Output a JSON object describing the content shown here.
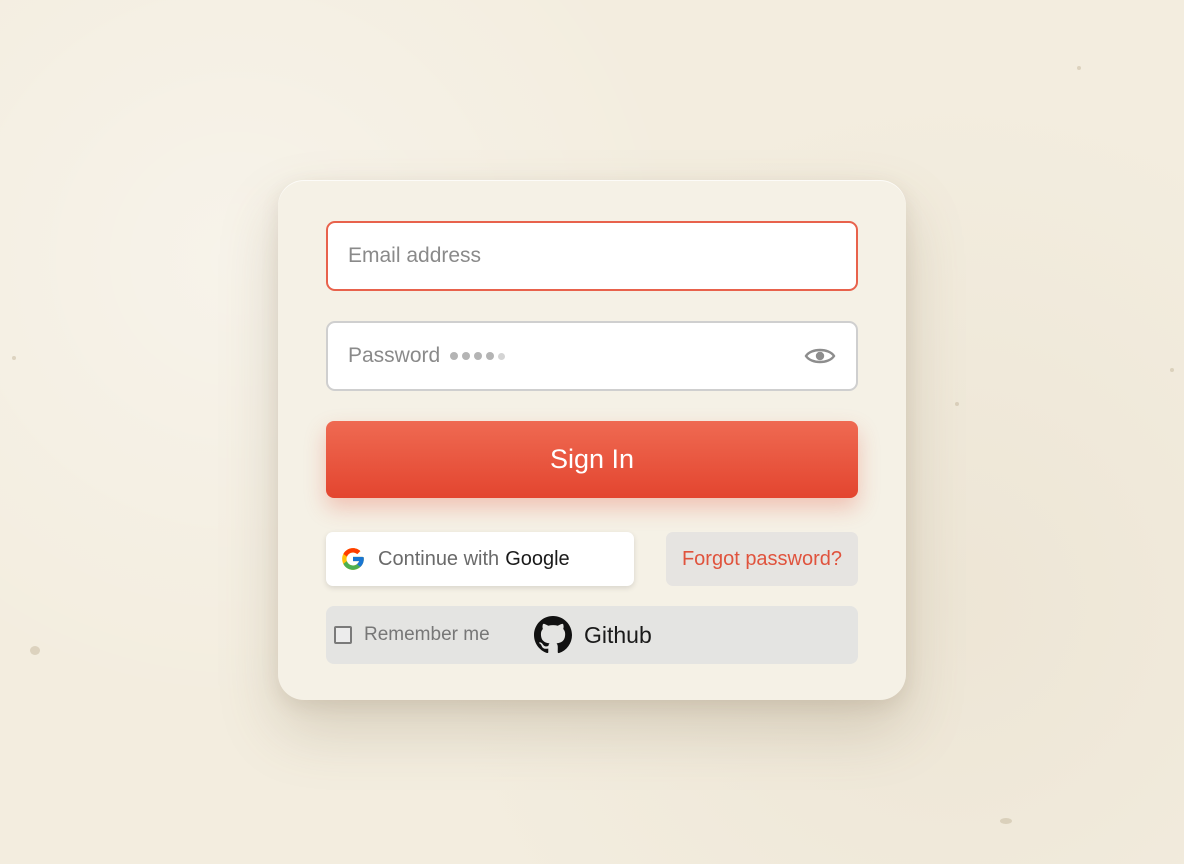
{
  "form": {
    "email": {
      "placeholder": "Email address"
    },
    "password": {
      "placeholder": "Password"
    },
    "sign_in_label": "Sign In",
    "google_prefix": "Continue with",
    "google_brand": "Google",
    "forgot_label": "Forgot password?",
    "remember_label": "Remember me",
    "github_label": "Github"
  },
  "icons": {
    "eye": "eye-icon",
    "google": "google-icon",
    "github": "github-icon",
    "checkbox": "checkbox"
  },
  "colors": {
    "accent": "#e8553e",
    "email_border": "#e8624c",
    "page_background": "#f3eddf",
    "card_background": "#f5f1e6"
  }
}
